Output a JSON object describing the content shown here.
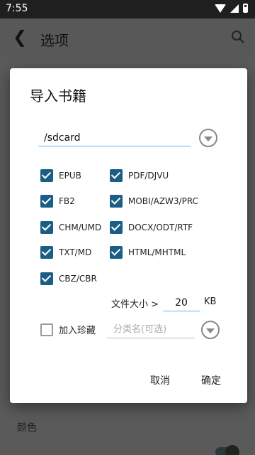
{
  "status": {
    "time": "7:55"
  },
  "appbar": {
    "back_icon": "back-arrow-icon",
    "title": "选项",
    "search_icon": "search-icon"
  },
  "background": {
    "section_label": "颜色"
  },
  "dialog": {
    "title": "导入书籍",
    "path_value": "/sdcard",
    "formats": [
      {
        "label": "EPUB",
        "checked": true
      },
      {
        "label": "PDF/DJVU",
        "checked": true
      },
      {
        "label": "FB2",
        "checked": true
      },
      {
        "label": "MOBI/AZW3/PRC",
        "checked": true
      },
      {
        "label": "CHM/UMD",
        "checked": true
      },
      {
        "label": "DOCX/ODT/RTF",
        "checked": true
      },
      {
        "label": "TXT/MD",
        "checked": true
      },
      {
        "label": "HTML/MHTML",
        "checked": true
      },
      {
        "label": "CBZ/CBR",
        "checked": true
      }
    ],
    "file_size_label": "文件大小 >",
    "file_size_value": "20",
    "file_size_unit": "KB",
    "favorites_label": "加入珍藏",
    "favorites_checked": false,
    "category_placeholder": "分类名(可选)",
    "cancel_label": "取消",
    "ok_label": "确定",
    "accent_color": "#1b5e85",
    "underline_color": "#64b5f6"
  }
}
